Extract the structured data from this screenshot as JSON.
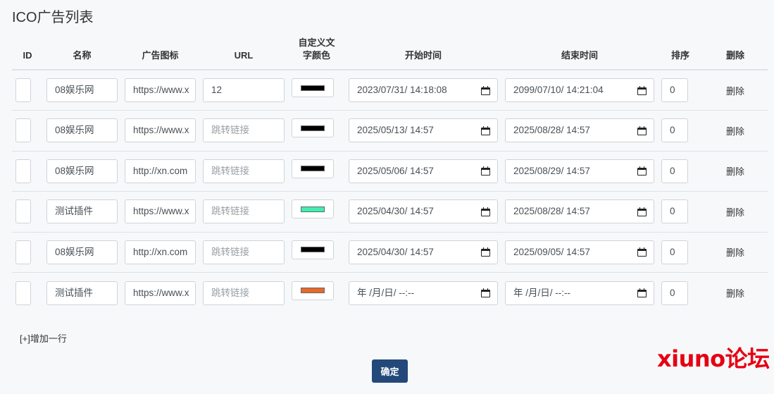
{
  "page": {
    "title": "ICO广告列表"
  },
  "table": {
    "headers": {
      "id": "ID",
      "name": "名称",
      "icon": "广告图标",
      "url": "URL",
      "color_line1": "自定义文",
      "color_line2": "字颜色",
      "start": "开始时间",
      "end": "结束时间",
      "sort": "排序",
      "delete": "删除"
    },
    "url_placeholder": "跳转链接",
    "rows": [
      {
        "id": "",
        "name": "08娱乐网",
        "icon": "https://www.x",
        "url": "12",
        "color": "#000000",
        "start": "2023/07/31/ 14:18:08",
        "end": "2099/07/10/ 14:21:04",
        "sort": "0",
        "delete": "删除"
      },
      {
        "id": "",
        "name": "08娱乐网",
        "icon": "https://www.x",
        "url": "",
        "color": "#000000",
        "start": "2025/05/13/ 14:57",
        "end": "2025/08/28/ 14:57",
        "sort": "0",
        "delete": "删除"
      },
      {
        "id": "",
        "name": "08娱乐网",
        "icon": "http://xn.com",
        "url": "",
        "color": "#000000",
        "start": "2025/05/06/ 14:57",
        "end": "2025/08/29/ 14:57",
        "sort": "0",
        "delete": "删除"
      },
      {
        "id": "",
        "name": "测试插件",
        "icon": "https://www.x",
        "url": "",
        "color": "#3ef0b0",
        "start": "2025/04/30/ 14:57",
        "end": "2025/08/28/ 14:57",
        "sort": "0",
        "delete": "删除"
      },
      {
        "id": "",
        "name": "08娱乐网",
        "icon": "http://xn.com",
        "url": "",
        "color": "#000000",
        "start": "2025/04/30/ 14:57",
        "end": "2025/09/05/ 14:57",
        "sort": "0",
        "delete": "删除"
      },
      {
        "id": "",
        "name": "测试插件",
        "icon": "https://www.x",
        "url": "",
        "color": "#e8692a",
        "start": " 年 /月/日/ --:--",
        "end": " 年 /月/日/ --:--",
        "sort": "0",
        "delete": "删除"
      }
    ]
  },
  "actions": {
    "add_row": "[+]增加一行",
    "confirm": "确定"
  },
  "watermark": "xiuno论坛"
}
